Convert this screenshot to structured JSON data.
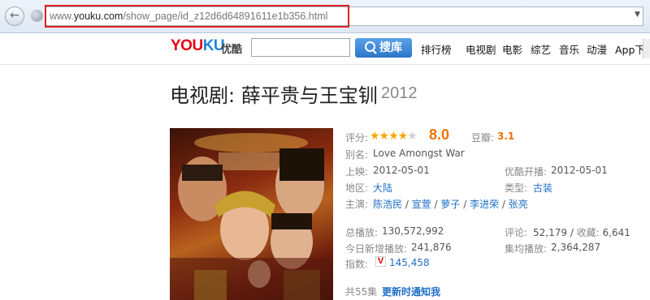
{
  "browser": {
    "back_icon": "arrow-left-icon",
    "url_prefix": "www.",
    "url_domain": "youku.com",
    "url_path": "/show_page/id_z12d6d64891611e1b356.html",
    "dropdown_glyph": "▼"
  },
  "header": {
    "logo_you": "YOU",
    "logo_ku": "KU",
    "logo_cn": "优酷",
    "search_value": "",
    "search_button": "搜库",
    "nav": [
      "排行榜",
      "电视剧",
      "电影",
      "综艺",
      "音乐",
      "动漫",
      "App下载"
    ]
  },
  "show": {
    "title": "电视剧: 薛平贵与王宝钏",
    "year": "2012",
    "rating_label": "评分:",
    "rating_stars": 4,
    "rating_score": "8.0",
    "douban_label": "豆瓣:",
    "douban_score": "3.1",
    "alias_label": "别名:",
    "alias": "Love Amongst War",
    "release_label": "上映:",
    "release": "2012-05-01",
    "youku_premiere_label": "优酷开播:",
    "youku_premiere": "2012-05-01",
    "region_label": "地区:",
    "region": "大陆",
    "genre_label": "类型:",
    "genre": "古装",
    "cast_label": "主演:",
    "cast": [
      "陈浩民",
      "宣萱",
      "萝子",
      "李进荣",
      "张亮"
    ],
    "total_plays_label": "总播放:",
    "total_plays": "130,572,992",
    "comments_label": "评论:",
    "comments": "52,179",
    "favorites_label": "收藏:",
    "favorites": "6,641",
    "today_plays_label": "今日新增播放:",
    "today_plays": "241,876",
    "episode_avg_label": "集均播放:",
    "episode_avg": "2,364,287",
    "index_label": "指数:",
    "index_icon": "V",
    "index": "145,458",
    "episodes_text": "共55集",
    "update_notify": "更新时通知我"
  }
}
